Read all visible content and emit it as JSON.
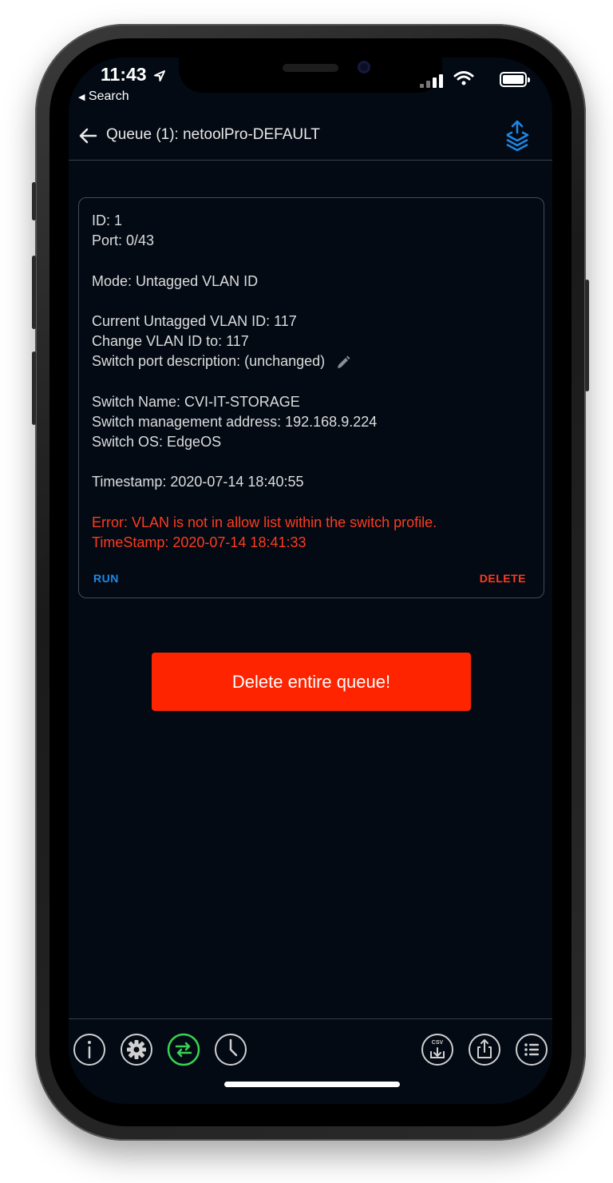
{
  "status_bar": {
    "time": "11:43",
    "back_app": "Search"
  },
  "app_bar": {
    "title": "Queue (1): netoolPro-DEFAULT"
  },
  "queue_item": {
    "id_line": "ID: 1",
    "port_line": "Port: 0/43",
    "mode_line": "Mode: Untagged VLAN ID",
    "current_vlan_line": "Current Untagged VLAN ID: 117",
    "change_vlan_line": "Change VLAN ID to: 117",
    "port_description_line": "Switch port description: (unchanged)",
    "switch_name_line": "Switch Name: CVI-IT-STORAGE",
    "switch_address_line": "Switch management address: 192.168.9.224",
    "switch_os_line": "Switch OS: EdgeOS",
    "timestamp_line": "Timestamp: 2020-07-14 18:40:55",
    "error_line": "Error: VLAN is not in allow list within the switch profile.",
    "error_timestamp_line": "TimeStamp: 2020-07-14 18:41:33",
    "run_label": "RUN",
    "delete_label": "DELETE"
  },
  "delete_queue_label": "Delete entire queue!",
  "toolbar": {
    "csv_label": "CSV",
    "icons": [
      "info-icon",
      "gear-icon",
      "swap-arrows-icon",
      "clock-icon",
      "csv-download-icon",
      "share-icon",
      "list-icon"
    ]
  },
  "colors": {
    "background": "#030a14",
    "accent_blue": "#1e88e5",
    "error_red": "#ff3b1f",
    "delete_button": "#ff2400",
    "active_icon": "#39d353"
  }
}
